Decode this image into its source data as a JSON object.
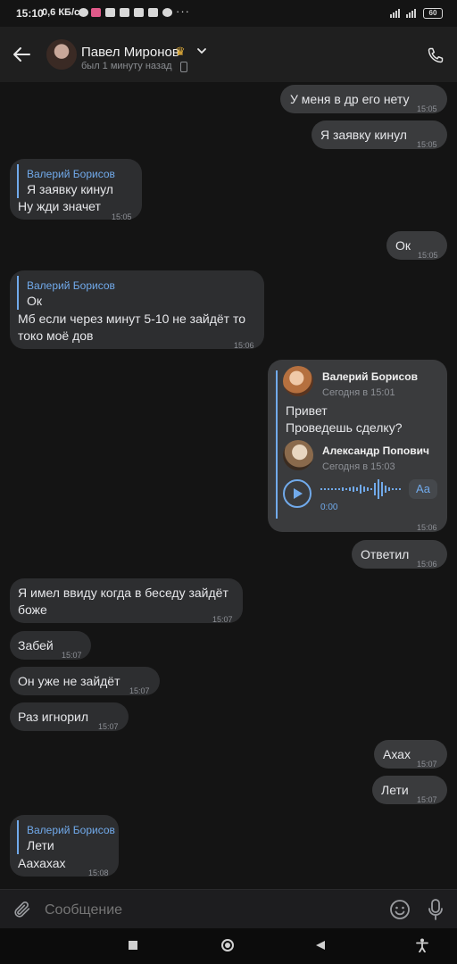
{
  "status_bar": {
    "time": "15:10",
    "network": "0,6 КБ/с",
    "dots": "···",
    "battery": "60"
  },
  "header": {
    "name": "Павел Миронов",
    "status": "был 1 минуту назад"
  },
  "messages": [
    {
      "side": "out",
      "text": "У меня в др его нету",
      "time": "15:05"
    },
    {
      "side": "out",
      "text": "Я заявку кинул",
      "time": "15:05"
    },
    {
      "side": "in",
      "reply_author": "Валерий Борисов",
      "reply_text": "Я заявку кинул",
      "text": "Ну жди значет",
      "time": "15:05"
    },
    {
      "side": "out",
      "text": "Ок",
      "time": "15:05"
    },
    {
      "side": "in",
      "reply_author": "Валерий Борисов",
      "reply_text": "Ок",
      "text_line1": "Мб если через минут 5-10 не зайдёт то",
      "text_line2": "токо моё дов",
      "time": "15:06"
    },
    {
      "side": "out",
      "forwarded": {
        "author": "Валерий Борисов",
        "date": "Сегодня в 15:01",
        "text_line1": "Привет",
        "text_line2": "Проведешь сделку?",
        "nested_author": "Александр Попович",
        "nested_date": "Сегодня в 15:03",
        "voice_duration": "0:00",
        "transcribe_label": "Aa"
      },
      "time": "15:06"
    },
    {
      "side": "out",
      "text": "Ответил",
      "time": "15:06"
    },
    {
      "side": "in",
      "text_line1": "Я имел ввиду когда в беседу зайдёт",
      "text_line2": "боже",
      "time": "15:07"
    },
    {
      "side": "in",
      "text": "Забей",
      "time": "15:07"
    },
    {
      "side": "in",
      "text": "Он уже не зайдёт",
      "time": "15:07"
    },
    {
      "side": "in",
      "text": "Раз игнорил",
      "time": "15:07"
    },
    {
      "side": "out",
      "text": "Ахах",
      "time": "15:07"
    },
    {
      "side": "out",
      "text": "Лети",
      "time": "15:07"
    },
    {
      "side": "in",
      "reply_author": "Валерий Борисов",
      "reply_text": "Лети",
      "text": "Аахахах",
      "time": "15:08"
    }
  ],
  "composer": {
    "placeholder": "Сообщение"
  },
  "colors": {
    "background": "#141414",
    "bubble_in": "#2d2e30",
    "bubble_out": "#3a3b3d",
    "accent": "#71aaeb"
  }
}
